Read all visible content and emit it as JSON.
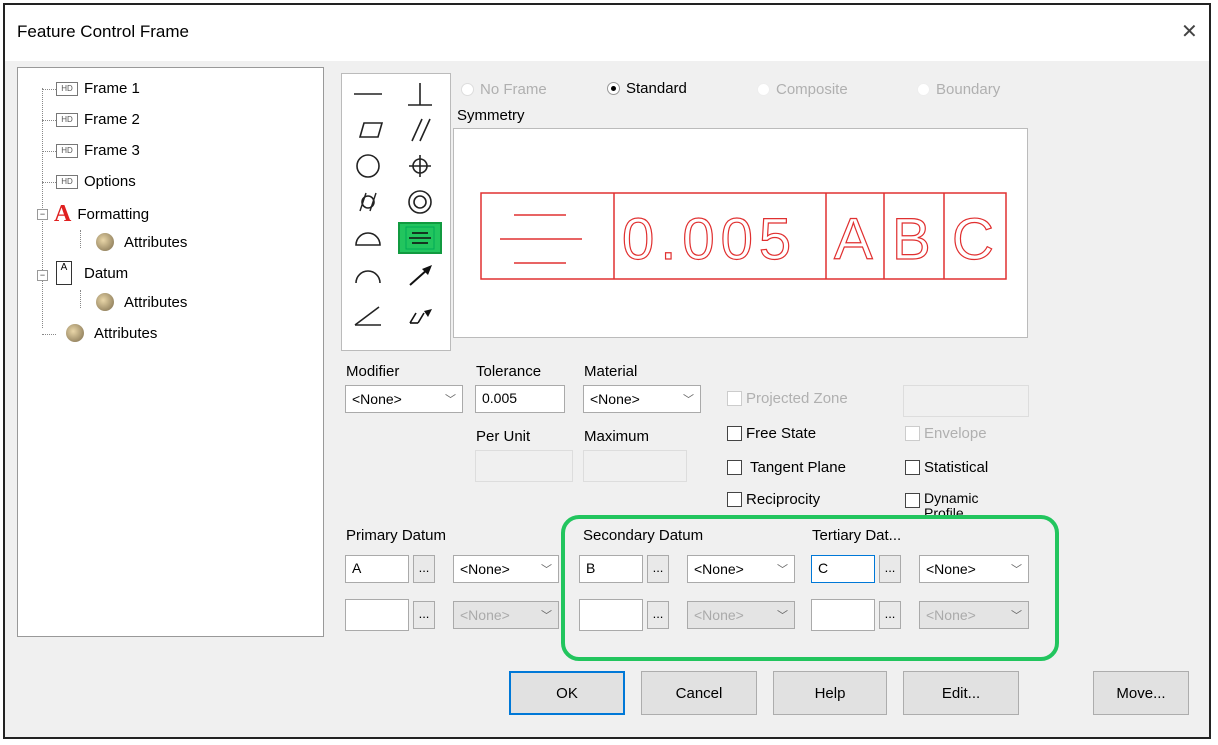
{
  "window": {
    "title": "Feature Control Frame",
    "close_label": "✕"
  },
  "tree": {
    "frame1": "Frame 1",
    "frame2": "Frame 2",
    "frame3": "Frame 3",
    "options": "Options",
    "formatting": "Formatting",
    "formatting_attributes": "Attributes",
    "datum": "Datum",
    "datum_attributes": "Attributes",
    "attributes": "Attributes",
    "frame_icon_text": "HD"
  },
  "frame_type": {
    "no_frame": "No Frame",
    "standard": "Standard",
    "composite": "Composite",
    "boundary": "Boundary"
  },
  "symmetry_label": "Symmetry",
  "preview": {
    "tolerance": "0.005",
    "datum_a": "A",
    "datum_b": "B",
    "datum_c": "C"
  },
  "modifier": {
    "label": "Modifier",
    "value": "<None>"
  },
  "tolerance": {
    "label": "Tolerance",
    "value": "0.005"
  },
  "material": {
    "label": "Material",
    "value": "<None>"
  },
  "per_unit_label": "Per Unit",
  "maximum_label": "Maximum",
  "checks": {
    "projected_zone": "Projected Zone",
    "free_state": "Free State",
    "tangent_plane": "Tangent Plane",
    "reciprocity": "Reciprocity",
    "envelope": "Envelope",
    "statistical": "Statistical",
    "dynamic_profile": "Dynamic Profile"
  },
  "primary": {
    "label": "Primary Datum",
    "value": "A",
    "combo": "<None>"
  },
  "secondary": {
    "label": "Secondary Datum",
    "value": "B",
    "combo": "<None>"
  },
  "tertiary": {
    "label": "Tertiary Dat...",
    "value": "C",
    "combo": "<None>"
  },
  "dots_label": "...",
  "buttons": {
    "ok": "OK",
    "cancel": "Cancel",
    "help": "Help",
    "edit": "Edit...",
    "move": "Move..."
  },
  "colors": {
    "accent": "#22c55e",
    "preview_red": "#e03030",
    "focus_blue": "#0078d7"
  }
}
